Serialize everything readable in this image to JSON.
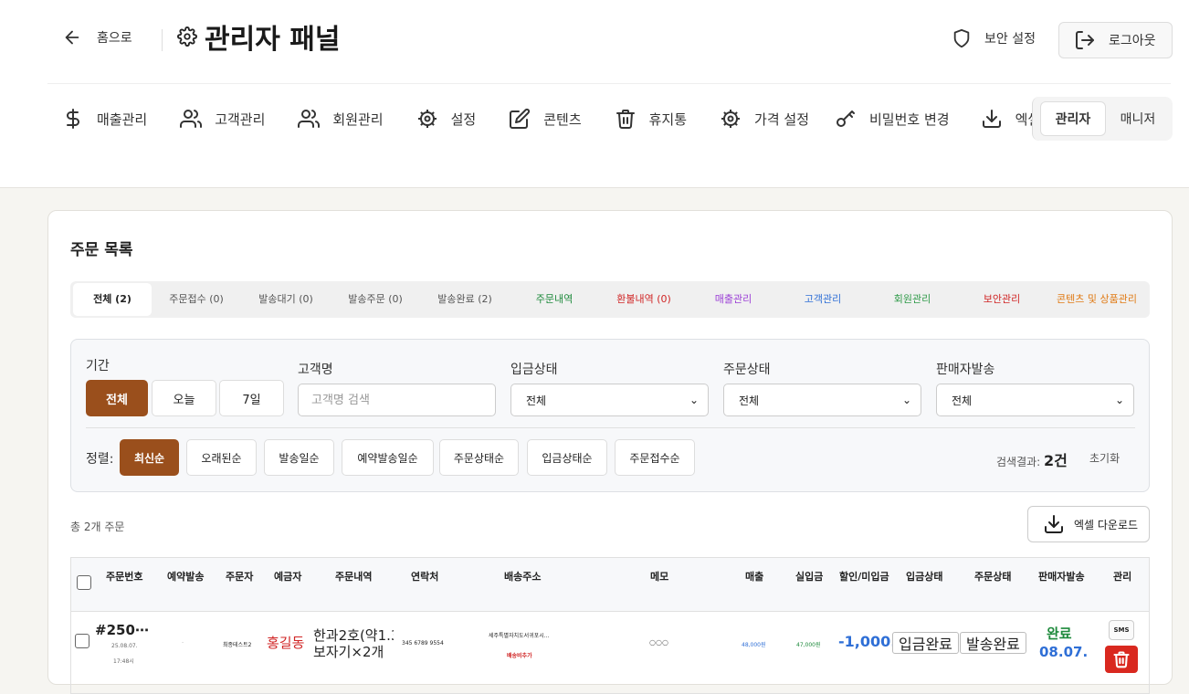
{
  "header": {
    "home_label": "홈으로",
    "title": "관리자 패널",
    "security_label": "보안 설정",
    "logout_label": "로그아웃"
  },
  "nav": [
    {
      "label": "매출관리",
      "icon": "dollar-icon"
    },
    {
      "label": "고객관리",
      "icon": "users-icon"
    },
    {
      "label": "회원관리",
      "icon": "users-icon"
    },
    {
      "label": "설정",
      "icon": "gear-icon"
    },
    {
      "label": "콘텐츠",
      "icon": "edit-icon"
    },
    {
      "label": "휴지통",
      "icon": "trash-icon"
    },
    {
      "label": "가격 설정",
      "icon": "gear-icon"
    },
    {
      "label": "비밀번호 변경",
      "icon": "key-icon"
    },
    {
      "label": "엑셀",
      "icon": "download-icon"
    }
  ],
  "roles": {
    "admin": "관리자",
    "manager": "매니저"
  },
  "card": {
    "title": "주문 목록",
    "tabs": [
      {
        "label": "전체 (2)",
        "color": "#222222"
      },
      {
        "label": "주문접수 (0)",
        "color": "#555555"
      },
      {
        "label": "발송대기 (0)",
        "color": "#555555"
      },
      {
        "label": "발송주문 (0)",
        "color": "#555555"
      },
      {
        "label": "발송완료 (2)",
        "color": "#555555"
      },
      {
        "label": "주문내역",
        "color": "#1e8a3c"
      },
      {
        "label": "환불내역 (0)",
        "color": "#d02525"
      },
      {
        "label": "매출관리",
        "color": "#9b3fd6"
      },
      {
        "label": "고객관리",
        "color": "#2f6fd6"
      },
      {
        "label": "회원관리",
        "color": "#2e9a48"
      },
      {
        "label": "보안관리",
        "color": "#d02525"
      },
      {
        "label": "콘텐츠 및 상품관리",
        "color": "#e07a14"
      }
    ]
  },
  "filters": {
    "period_label": "기간",
    "periods": [
      "전체",
      "오늘",
      "7일"
    ],
    "customer_label": "고객명",
    "customer_placeholder": "고객명 검색",
    "deposit_label": "입금상태",
    "deposit_value": "전체",
    "order_status_label": "주문상태",
    "order_status_value": "전체",
    "seller_label": "판매자발송",
    "seller_value": "전체",
    "sort_label": "정렬:",
    "sorts": [
      "최신순",
      "오래된순",
      "발송일순",
      "예약발송일순",
      "주문상태순",
      "입금상태순",
      "주문접수순"
    ],
    "result_label": "검색결과:",
    "result_count": "2건",
    "reset_label": "초기화"
  },
  "list": {
    "total": "총 2개 주문",
    "excel_label": "엑셀 다운로드"
  },
  "table": {
    "headers": [
      "주문번호",
      "예약발송",
      "주문자",
      "예금자",
      "주문내역",
      "연락처",
      "배송주소",
      "메모",
      "매출",
      "실입금",
      "할인/미입금",
      "입금상태",
      "주문상태",
      "판매자발송",
      "관리"
    ],
    "row": {
      "order_no": "#250⋯",
      "date": "25.08.07.",
      "time": "17:48시",
      "reserve": "-",
      "orderer": "최종테스트2",
      "depositor": "홍길동",
      "items_line1": "한과2호(약1.3",
      "items_line2": "보자기×2개",
      "phone": "345 6789 9554",
      "address": "세주특별자치도서귀포시...",
      "delivery_fee": "배송비추가",
      "memo": "○○○",
      "sales": "48,000원",
      "paid": "47,000원",
      "discount": "-1,000...",
      "deposit_status": "입금완료",
      "order_status": "발송완료",
      "seller_status": "완료",
      "seller_date": "08.07.",
      "sms": "SMS"
    }
  },
  "colors": {
    "accent": "#9a4f1c",
    "danger": "#d9281f",
    "blue": "#2f6fd6",
    "green": "#1e8a3c"
  }
}
